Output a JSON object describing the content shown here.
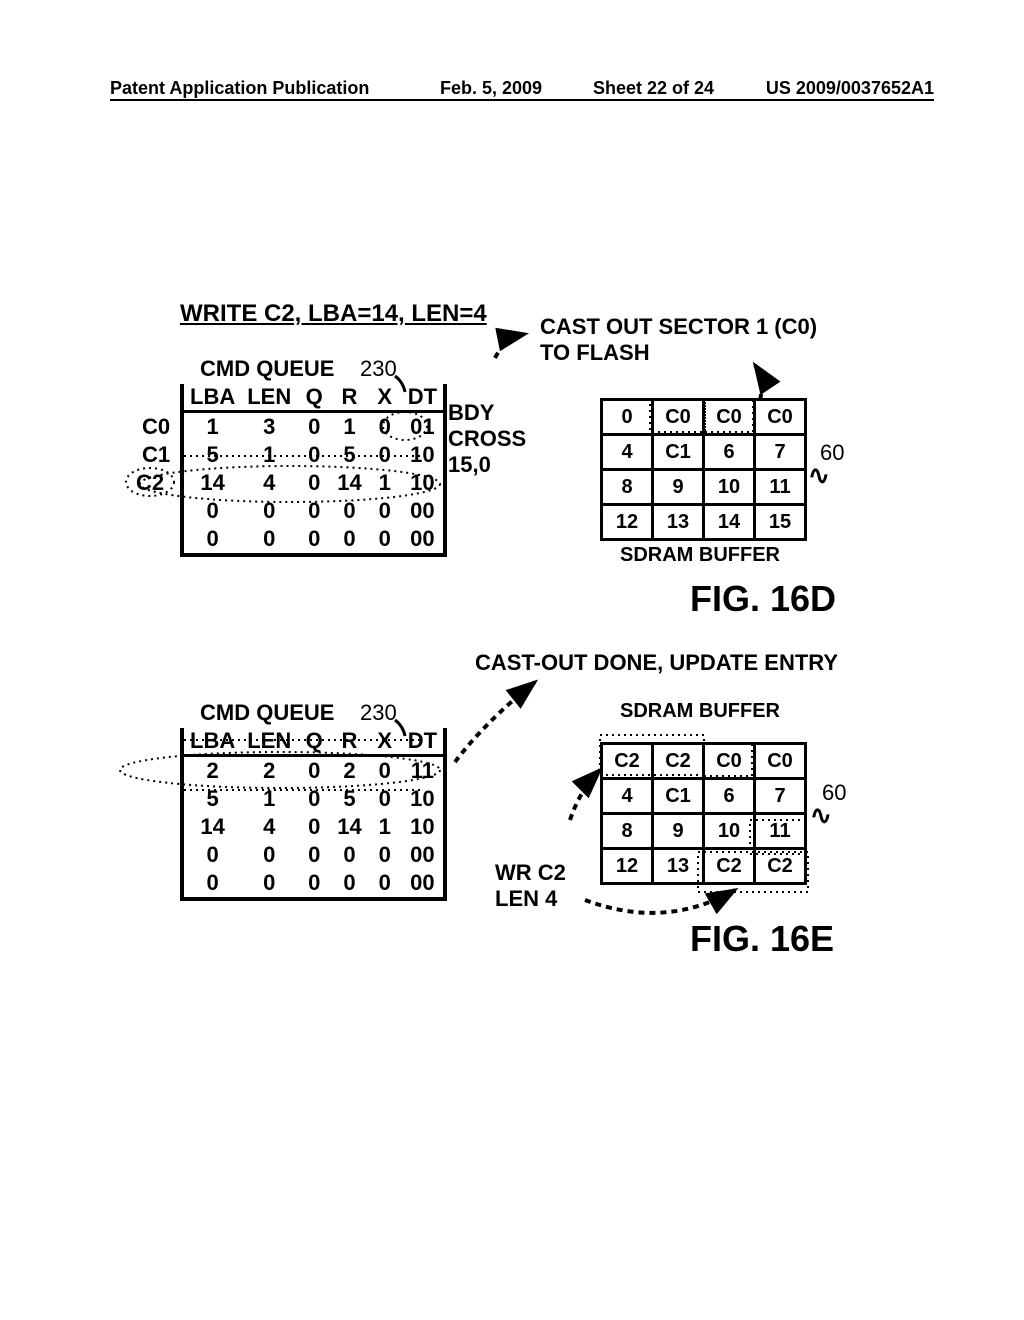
{
  "header": {
    "left": "Patent Application Publication",
    "date": "Feb. 5, 2009",
    "sheet": "Sheet 22 of 24",
    "pubno": "US 2009/0037652A1"
  },
  "fig16d": {
    "title": "WRITE C2, LBA=14, LEN=4",
    "cast_label": "CAST OUT SECTOR 1 (C0)\nTO FLASH",
    "queue_label": "CMD QUEUE",
    "queue_ref": "230",
    "cols": [
      "LBA",
      "LEN",
      "Q",
      "R",
      "X",
      "DT"
    ],
    "row_labels": [
      "C0",
      "C1",
      "C2"
    ],
    "rows": [
      [
        "1",
        "3",
        "0",
        "1",
        "0",
        "01"
      ],
      [
        "5",
        "1",
        "0",
        "5",
        "0",
        "10"
      ],
      [
        "14",
        "4",
        "0",
        "14",
        "1",
        "10"
      ],
      [
        "0",
        "0",
        "0",
        "0",
        "0",
        "00"
      ],
      [
        "0",
        "0",
        "0",
        "0",
        "0",
        "00"
      ]
    ],
    "bdy_label": "BDY\nCROSS\n15,0",
    "buffer_ref": "60",
    "buffer_caption": "SDRAM BUFFER",
    "buffer": [
      [
        "0",
        "C0",
        "C0",
        "C0"
      ],
      [
        "4",
        "C1",
        "6",
        "7"
      ],
      [
        "8",
        "9",
        "10",
        "11"
      ],
      [
        "12",
        "13",
        "14",
        "15"
      ]
    ],
    "fig_label": "FIG. 16D"
  },
  "fig16e": {
    "castout_label": "CAST-OUT DONE, UPDATE ENTRY",
    "queue_label": "CMD QUEUE",
    "queue_ref": "230",
    "cols": [
      "LBA",
      "LEN",
      "Q",
      "R",
      "X",
      "DT"
    ],
    "rows": [
      [
        "2",
        "2",
        "0",
        "2",
        "0",
        "11"
      ],
      [
        "5",
        "1",
        "0",
        "5",
        "0",
        "10"
      ],
      [
        "14",
        "4",
        "0",
        "14",
        "1",
        "10"
      ],
      [
        "0",
        "0",
        "0",
        "0",
        "0",
        "00"
      ],
      [
        "0",
        "0",
        "0",
        "0",
        "0",
        "00"
      ]
    ],
    "wr_label": "WR C2\nLEN 4",
    "buffer_ref": "60",
    "buffer_caption": "SDRAM BUFFER",
    "buffer": [
      [
        "C2",
        "C2",
        "C0",
        "C0"
      ],
      [
        "4",
        "C1",
        "6",
        "7"
      ],
      [
        "8",
        "9",
        "10",
        "11"
      ],
      [
        "12",
        "13",
        "C2",
        "C2"
      ]
    ],
    "fig_label": "FIG. 16E"
  }
}
